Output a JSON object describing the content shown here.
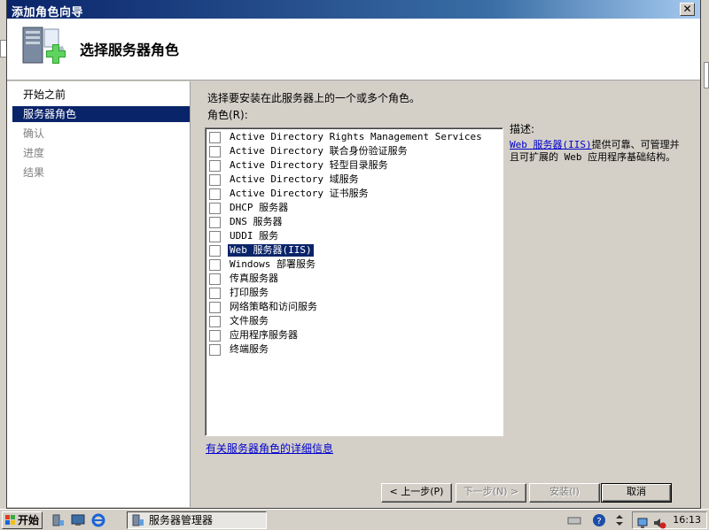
{
  "window": {
    "title": "添加角色向导",
    "close_glyph": "✕"
  },
  "header": {
    "title": "选择服务器角色",
    "icon": "server-add-icon"
  },
  "sidebar": {
    "items": [
      {
        "label": "开始之前",
        "state": "normal"
      },
      {
        "label": "服务器角色",
        "state": "active"
      },
      {
        "label": "确认",
        "state": "disabled"
      },
      {
        "label": "进度",
        "state": "disabled"
      },
      {
        "label": "结果",
        "state": "disabled"
      }
    ]
  },
  "main": {
    "instruction": "选择要安装在此服务器上的一个或多个角色。",
    "roles_label": "角色(R):",
    "roles": [
      {
        "label": "Active Directory Rights Management Services",
        "checked": false,
        "selected": false
      },
      {
        "label": "Active Directory 联合身份验证服务",
        "checked": false,
        "selected": false
      },
      {
        "label": "Active Directory 轻型目录服务",
        "checked": false,
        "selected": false
      },
      {
        "label": "Active Directory 域服务",
        "checked": false,
        "selected": false
      },
      {
        "label": "Active Directory 证书服务",
        "checked": false,
        "selected": false
      },
      {
        "label": "DHCP 服务器",
        "checked": false,
        "selected": false
      },
      {
        "label": "DNS 服务器",
        "checked": false,
        "selected": false
      },
      {
        "label": "UDDI 服务",
        "checked": false,
        "selected": false
      },
      {
        "label": "Web 服务器(IIS)",
        "checked": false,
        "selected": true
      },
      {
        "label": "Windows 部署服务",
        "checked": false,
        "selected": false
      },
      {
        "label": "传真服务器",
        "checked": false,
        "selected": false
      },
      {
        "label": "打印服务",
        "checked": false,
        "selected": false
      },
      {
        "label": "网络策略和访问服务",
        "checked": false,
        "selected": false
      },
      {
        "label": "文件服务",
        "checked": false,
        "selected": false
      },
      {
        "label": "应用程序服务器",
        "checked": false,
        "selected": false
      },
      {
        "label": "终端服务",
        "checked": false,
        "selected": false
      }
    ],
    "more_info_link": "有关服务器角色的详细信息"
  },
  "description": {
    "label": "描述:",
    "link": "Web 服务器(IIS)",
    "text": "提供可靠、可管理并且可扩展的 Web 应用程序基础结构。"
  },
  "buttons": {
    "back": "< 上一步(P)",
    "next": "下一步(N) >",
    "install": "安装(I)",
    "cancel": "取消"
  },
  "taskbar": {
    "start": "开始",
    "task_label": "服务器管理器",
    "clock": "16:13"
  },
  "colors": {
    "selection": "#0a246a",
    "link": "#0000cc",
    "titlebar_start": "#0a246a",
    "desktop": "#3a6ea5"
  }
}
